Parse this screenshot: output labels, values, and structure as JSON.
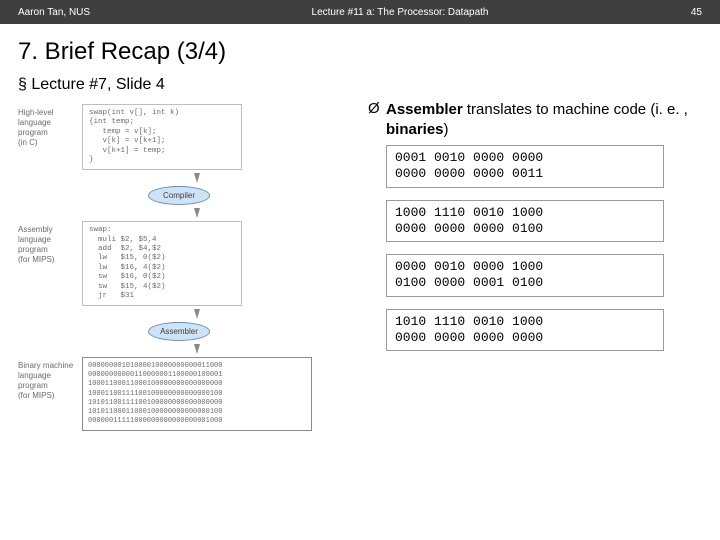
{
  "topbar": {
    "left": "Aaron Tan, NUS",
    "center": "Lecture #11 a: The Processor: Datapath",
    "right": "45"
  },
  "title": "7. Brief Recap (3/4)",
  "sub": "Lecture #7, Slide 4",
  "diagram": {
    "hl_label": "High-level\nlanguage\nprogram\n(in C)",
    "hl_code": "swap(int v[], int k)\n{int temp;\n   temp = v[k];\n   v[k] = v[k+1];\n   v[k+1] = temp;\n}",
    "proc1": "Compiler",
    "asm_label": "Assembly\nlanguage\nprogram\n(for MIPS)",
    "asm_code": "swap:\n  muli $2, $5,4\n  add  $2, $4,$2\n  lw   $15, 0($2)\n  lw   $16, 4($2)\n  sw   $16, 0($2)\n  sw   $15, 4($2)\n  jr   $31",
    "proc2": "Assembler",
    "bin_label": "Binary machine\nlanguage\nprogram\n(for MIPS)",
    "bin_code": "00000000101000010000000000011000\n00000000000110000001100000100001\n10001100011000100000000000000000\n10001100111100100000000000000100\n10101100111100100000000000000000\n10101100011000100000000000000100\n00000011111000000000000000001000"
  },
  "rhs": {
    "text_pre": "Assembler",
    "text_mid": " translates to machine code (i. e. , ",
    "text_bold2": "binaries",
    "text_end": ")",
    "mc1": "0001 0010 0000 0000\n0000 0000 0000 0011",
    "mc2": "1000 1110 0010 1000\n0000 0000 0000 0100",
    "mc3": "0000 0010 0000 1000\n0100 0000 0001 0100",
    "mc4": "1010 1110 0010 1000\n0000 0000 0000 0000"
  }
}
